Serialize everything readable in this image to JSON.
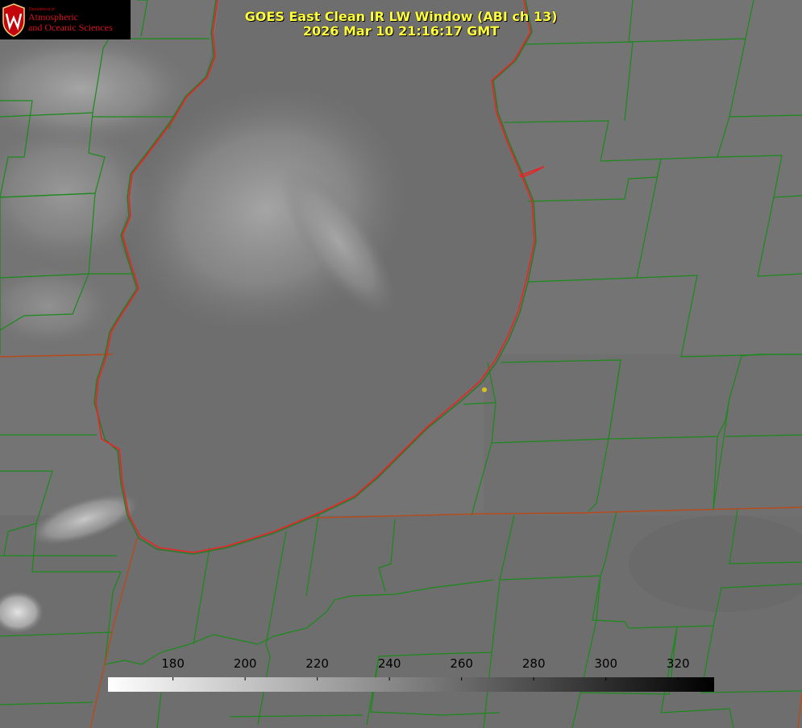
{
  "header": {
    "title": "GOES East Clean IR LW Window (ABI ch 13)",
    "timestamp": "2026 Mar 10 21:16:17 GMT"
  },
  "logo": {
    "department": "Department of",
    "line1": "Atmospheric",
    "line2": "and Oceanic Sciences"
  },
  "colorbar": {
    "ticks": [
      "180",
      "200",
      "220",
      "240",
      "260",
      "280",
      "300",
      "320"
    ],
    "range": [
      162,
      330
    ],
    "gradient": [
      "#ffffff",
      "#000000"
    ]
  },
  "map_colors": {
    "county_lines": "#1a8a1a",
    "state_lines": "#b84a1a",
    "lake_outline": "#ee2222",
    "marker": "#d6c21a"
  }
}
